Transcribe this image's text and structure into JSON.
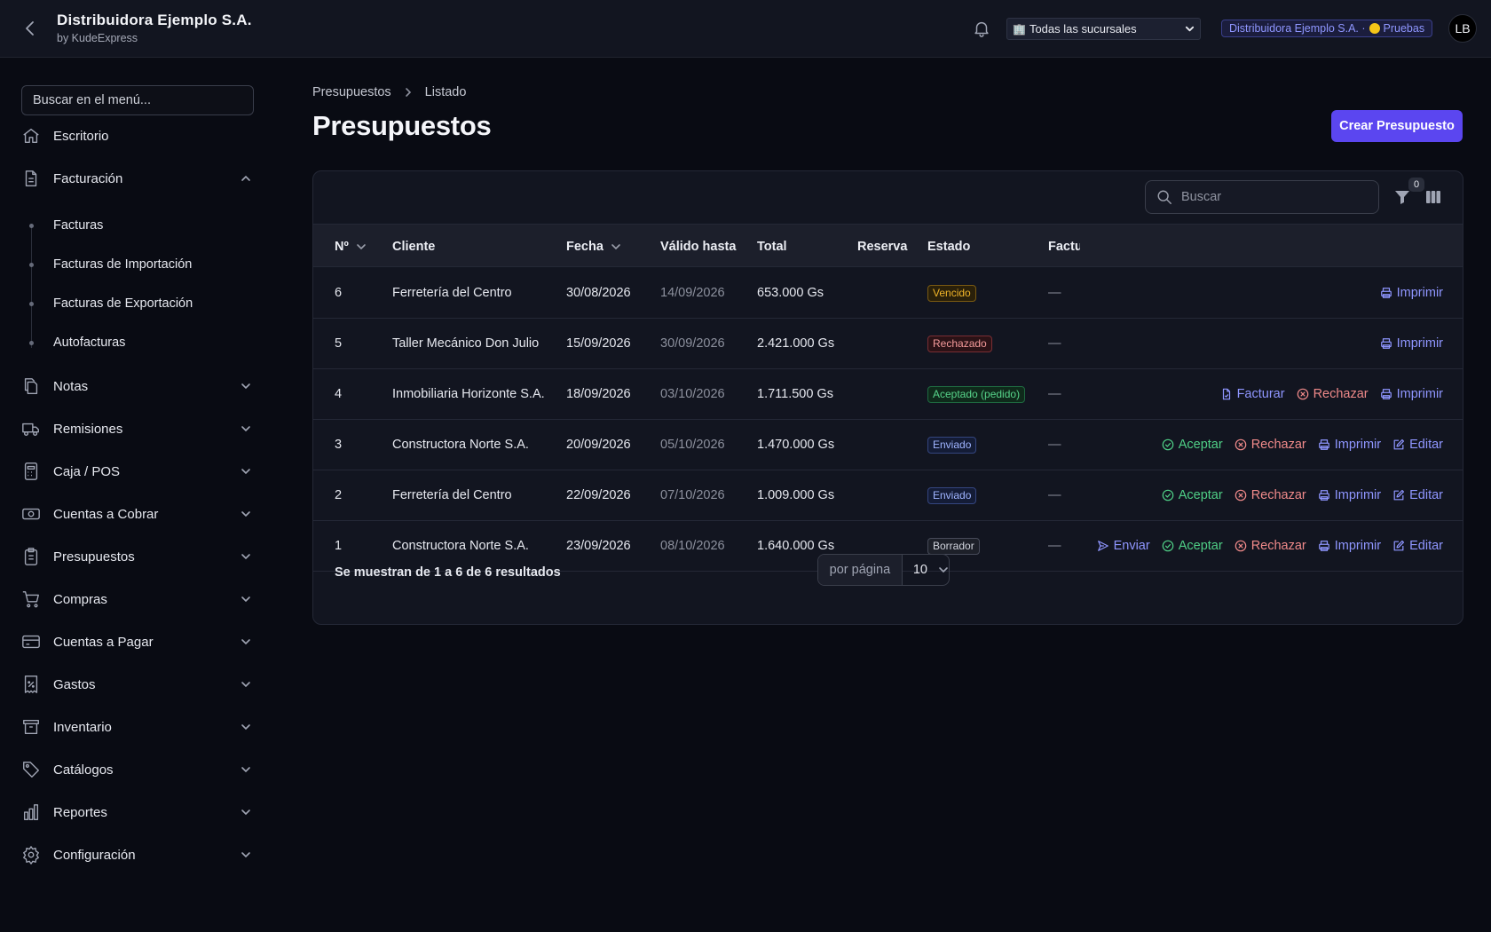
{
  "header": {
    "title": "Distribuidora Ejemplo S.A.",
    "subtitle": "by KudeExpress",
    "branch_select": "Todas las sucursales",
    "env_company": "Distribuidora Ejemplo S.A. ·",
    "env_mode": "Pruebas",
    "avatar_initials": "LB"
  },
  "sidebar": {
    "search_placeholder": "Buscar en el menú...",
    "items": [
      {
        "label": "Escritorio",
        "icon": "home-icon"
      },
      {
        "label": "Facturación",
        "icon": "document-icon",
        "expanded": true
      },
      {
        "label": "Notas",
        "icon": "copy-icon"
      },
      {
        "label": "Remisiones",
        "icon": "truck-icon"
      },
      {
        "label": "Caja / POS",
        "icon": "calculator-icon"
      },
      {
        "label": "Cuentas a Cobrar",
        "icon": "cash-icon"
      },
      {
        "label": "Presupuestos",
        "icon": "clipboard-icon"
      },
      {
        "label": "Compras",
        "icon": "cart-icon"
      },
      {
        "label": "Cuentas a Pagar",
        "icon": "credit-card-icon"
      },
      {
        "label": "Gastos",
        "icon": "receipt-icon"
      },
      {
        "label": "Inventario",
        "icon": "archive-icon"
      },
      {
        "label": "Catálogos",
        "icon": "tag-icon"
      },
      {
        "label": "Reportes",
        "icon": "bar-chart-icon"
      },
      {
        "label": "Configuración",
        "icon": "gear-icon"
      }
    ],
    "facturacion_sub": [
      "Facturas",
      "Facturas de Importación",
      "Facturas de Exportación",
      "Autofacturas"
    ]
  },
  "main": {
    "breadcrumb": [
      "Presupuestos",
      "Listado"
    ],
    "title": "Presupuestos",
    "create_button": "Crear Presupuesto",
    "search_placeholder": "Buscar",
    "filter_count": "0",
    "columns": [
      "Nº",
      "Cliente",
      "Fecha",
      "Válido hasta",
      "Total",
      "Reserva",
      "Estado",
      "Factu"
    ],
    "rows": [
      {
        "num": "6",
        "cliente": "Ferretería del Centro",
        "fecha": "30/08/2026",
        "valido": "14/09/2026",
        "total": "653.000 Gs",
        "estado": "Vencido",
        "factura": "—",
        "actions": [
          "Imprimir"
        ]
      },
      {
        "num": "5",
        "cliente": "Taller Mecánico Don Julio",
        "fecha": "15/09/2026",
        "valido": "30/09/2026",
        "total": "2.421.000 Gs",
        "estado": "Rechazado",
        "factura": "—",
        "actions": [
          "Imprimir"
        ]
      },
      {
        "num": "4",
        "cliente": "Inmobiliaria Horizonte S.A.",
        "fecha": "18/09/2026",
        "valido": "03/10/2026",
        "total": "1.711.500 Gs",
        "estado": "Aceptado (pedido)",
        "factura": "—",
        "actions": [
          "Facturar",
          "Rechazar",
          "Imprimir"
        ]
      },
      {
        "num": "3",
        "cliente": "Constructora Norte S.A.",
        "fecha": "20/09/2026",
        "valido": "05/10/2026",
        "total": "1.470.000 Gs",
        "estado": "Enviado",
        "factura": "—",
        "actions": [
          "Aceptar",
          "Rechazar",
          "Imprimir",
          "Editar"
        ]
      },
      {
        "num": "2",
        "cliente": "Ferretería del Centro",
        "fecha": "22/09/2026",
        "valido": "07/10/2026",
        "total": "1.009.000 Gs",
        "estado": "Enviado",
        "factura": "—",
        "actions": [
          "Aceptar",
          "Rechazar",
          "Imprimir",
          "Editar"
        ]
      },
      {
        "num": "1",
        "cliente": "Constructora Norte S.A.",
        "fecha": "23/09/2026",
        "valido": "08/10/2026",
        "total": "1.640.000 Gs",
        "estado": "Borrador",
        "factura": "—",
        "actions": [
          "Enviar",
          "Aceptar",
          "Rechazar",
          "Imprimir",
          "Editar"
        ]
      }
    ],
    "footer_text": "Se muestran de 1 a 6 de 6 resultados",
    "per_page_label": "por página",
    "per_page_value": "10"
  },
  "colors": {
    "accent": "#5b46f0",
    "link_blue": "#8f96ff",
    "accept_green": "#4fcf86",
    "reject_red": "#f08a8a"
  }
}
